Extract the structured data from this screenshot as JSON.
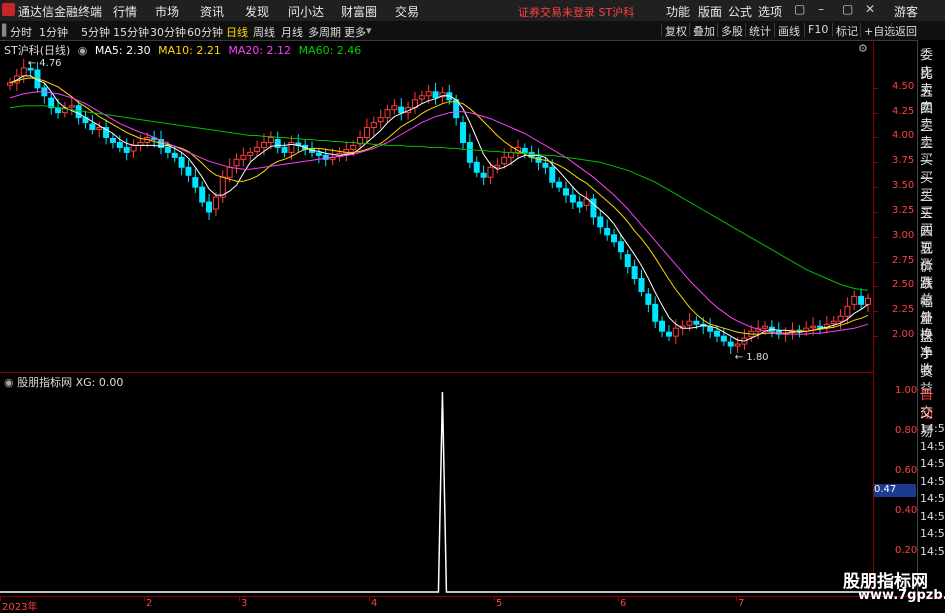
{
  "app": {
    "title": "通达信金融终端"
  },
  "menu": [
    "行情",
    "市场",
    "资讯",
    "发现",
    "问小达",
    "财富圈",
    "交易"
  ],
  "notice": "证券交易未登录  ST沪科",
  "right_menu": [
    "功能",
    "版面",
    "公式",
    "选项"
  ],
  "user": "游客",
  "window_buttons": [
    "▢",
    "–",
    "▢",
    "✕"
  ],
  "periods": [
    "分时",
    "1分钟",
    "5分钟",
    "15分钟",
    "30分钟",
    "60分钟",
    "日线",
    "周线",
    "月线",
    "多周期",
    "更多"
  ],
  "active_period": "日线",
  "chart_tools": [
    "复权",
    "叠加",
    "多股",
    "统计",
    "画线",
    "F10",
    "标记",
    "+自选",
    "返回"
  ],
  "main_legend": {
    "stock": "ST沪科(日线)",
    "ma5": "MA5: 2.30",
    "ma10": "MA10: 2.21",
    "ma20": "MA20: 2.12",
    "ma60": "MA60: 2.46"
  },
  "indicator_legend": {
    "name": "股朋指标网",
    "xg": "XG: 0.00"
  },
  "side_panel": [
    "委比",
    "卖五",
    "卖四",
    "卖三",
    "卖二",
    "卖一",
    "买一",
    "买二",
    "买三",
    "买四",
    "买五",
    "现价",
    "涨跌",
    "涨幅",
    "总量",
    "外盘",
    "换手",
    "净资",
    "收益"
  ],
  "side_bottom": [
    "自动",
    "交易"
  ],
  "side_times": [
    "14:53",
    "14:54",
    "14:54",
    "14:55",
    "14:55",
    "14:55",
    "14:55",
    "14:56"
  ],
  "xg_marker": "0.47",
  "x_dates": [
    "2023年",
    "2",
    "3",
    "4",
    "5",
    "6",
    "7"
  ],
  "watermark": {
    "line1": "股朋指标网",
    "line2": "www.7gpzb.com"
  },
  "colors": {
    "up": "#ff3c3c",
    "down": "#00e5ff",
    "ma5": "#ffffff",
    "ma10": "#ffd700",
    "ma20": "#ff40ff",
    "ma60": "#00c000",
    "axis": "#8b0000"
  },
  "chart_data": [
    {
      "type": "candlestick",
      "title": "ST沪科(日线)",
      "ylim": [
        1.8,
        4.76
      ],
      "y_ticks": [
        4.5,
        4.25,
        4.0,
        3.75,
        3.5,
        3.25,
        3.0,
        2.75,
        2.5,
        2.25,
        2.0
      ],
      "annotations": [
        {
          "label": "4.76",
          "type": "high"
        },
        {
          "label": "1.80",
          "type": "low"
        }
      ],
      "closes": [
        4.55,
        4.62,
        4.7,
        4.68,
        4.5,
        4.42,
        4.3,
        4.25,
        4.3,
        4.32,
        4.2,
        4.15,
        4.08,
        4.1,
        4.0,
        3.95,
        3.9,
        3.85,
        3.92,
        3.95,
        4.0,
        3.98,
        3.9,
        3.85,
        3.8,
        3.7,
        3.62,
        3.5,
        3.35,
        3.25,
        3.4,
        3.6,
        3.7,
        3.78,
        3.82,
        3.85,
        3.9,
        3.95,
        4.0,
        3.9,
        3.85,
        3.95,
        3.92,
        3.88,
        3.85,
        3.82,
        3.78,
        3.8,
        3.84,
        3.88,
        3.92,
        4.0,
        4.1,
        4.15,
        4.2,
        4.28,
        4.32,
        4.25,
        4.3,
        4.38,
        4.42,
        4.46,
        4.4,
        4.45,
        4.38,
        4.2,
        3.95,
        3.75,
        3.65,
        3.6,
        3.7,
        3.72,
        3.8,
        3.85,
        3.9,
        3.85,
        3.8,
        3.75,
        3.7,
        3.55,
        3.5,
        3.42,
        3.35,
        3.3,
        3.38,
        3.2,
        3.1,
        3.02,
        2.95,
        2.85,
        2.7,
        2.58,
        2.45,
        2.32,
        2.15,
        2.05,
        2.0,
        2.08,
        2.1,
        2.15,
        2.12,
        2.1,
        2.05,
        2.0,
        1.95,
        1.9,
        1.92,
        1.98,
        2.05,
        2.08,
        2.1,
        2.05,
        2.02,
        2.03,
        2.06,
        2.05,
        2.08,
        2.1,
        2.09,
        2.12,
        2.15,
        2.2,
        2.3,
        2.4,
        2.32,
        2.38
      ],
      "ma_series": [
        {
          "name": "MA5",
          "values": [
            4.55,
            4.58,
            4.62,
            4.62,
            4.58,
            4.55,
            4.46,
            4.36,
            4.3,
            4.27,
            4.24,
            4.2,
            4.16,
            4.12,
            4.08,
            4.04,
            3.98,
            3.94,
            3.92,
            3.92,
            3.92,
            3.92,
            3.91,
            3.92,
            3.89,
            3.85,
            3.79,
            3.7,
            3.6,
            3.48,
            3.42,
            3.42,
            3.46,
            3.52,
            3.64,
            3.75,
            3.81,
            3.86,
            3.91,
            3.92,
            3.92,
            3.93,
            3.92,
            3.9,
            3.87,
            3.86,
            3.84,
            3.83,
            3.82,
            3.83,
            3.84,
            3.89,
            3.95,
            4.01,
            4.07,
            4.15,
            4.21,
            4.24,
            4.27,
            4.3,
            4.34,
            4.37,
            4.39,
            4.42,
            4.42,
            4.38,
            4.29,
            4.15,
            3.99,
            3.83,
            3.73,
            3.68,
            3.7,
            3.74,
            3.79,
            3.82,
            3.82,
            3.82,
            3.8,
            3.73,
            3.66,
            3.58,
            3.5,
            3.43,
            3.39,
            3.33,
            3.27,
            3.21,
            3.13,
            3.02,
            2.92,
            2.82,
            2.71,
            2.58,
            2.44,
            2.31,
            2.19,
            2.12,
            2.08,
            2.08,
            2.09,
            2.11,
            2.1,
            2.08,
            2.04,
            2.0,
            1.96,
            1.95,
            1.98,
            2.01,
            2.05,
            2.07,
            2.06,
            2.06,
            2.05,
            2.04,
            2.05,
            2.06,
            2.08,
            2.09,
            2.11,
            2.13,
            2.17,
            2.23,
            2.27,
            2.32
          ]
        },
        {
          "name": "MA10",
          "values": [
            4.55,
            4.57,
            4.59,
            4.6,
            4.59,
            4.57,
            4.54,
            4.51,
            4.46,
            4.41,
            4.35,
            4.31,
            4.26,
            4.21,
            4.17,
            4.13,
            4.09,
            4.05,
            4.02,
            3.99,
            3.98,
            3.96,
            3.94,
            3.93,
            3.91,
            3.89,
            3.86,
            3.8,
            3.74,
            3.67,
            3.62,
            3.6,
            3.58,
            3.56,
            3.56,
            3.58,
            3.61,
            3.66,
            3.72,
            3.76,
            3.78,
            3.81,
            3.85,
            3.88,
            3.89,
            3.89,
            3.88,
            3.87,
            3.86,
            3.85,
            3.85,
            3.86,
            3.88,
            3.91,
            3.94,
            3.99,
            4.05,
            4.11,
            4.15,
            4.19,
            4.24,
            4.28,
            4.31,
            4.34,
            4.36,
            4.36,
            4.34,
            4.29,
            4.23,
            4.16,
            4.09,
            4.02,
            3.96,
            3.91,
            3.87,
            3.83,
            3.8,
            3.78,
            3.77,
            3.75,
            3.72,
            3.68,
            3.63,
            3.58,
            3.54,
            3.48,
            3.42,
            3.36,
            3.3,
            3.23,
            3.15,
            3.06,
            2.98,
            2.89,
            2.79,
            2.68,
            2.57,
            2.47,
            2.38,
            2.29,
            2.22,
            2.16,
            2.12,
            2.1,
            2.08,
            2.06,
            2.04,
            2.03,
            2.02,
            2.02,
            2.03,
            2.03,
            2.03,
            2.03,
            2.04,
            2.05,
            2.05,
            2.06,
            2.07,
            2.08,
            2.09,
            2.11,
            2.13,
            2.16,
            2.18,
            2.21
          ]
        },
        {
          "name": "MA20",
          "values": [
            4.4,
            4.42,
            4.44,
            4.45,
            4.46,
            4.46,
            4.45,
            4.44,
            4.42,
            4.4,
            4.37,
            4.34,
            4.3,
            4.26,
            4.22,
            4.18,
            4.14,
            4.11,
            4.08,
            4.05,
            4.03,
            4.0,
            3.97,
            3.94,
            3.91,
            3.88,
            3.85,
            3.82,
            3.79,
            3.76,
            3.74,
            3.72,
            3.7,
            3.69,
            3.68,
            3.68,
            3.69,
            3.7,
            3.71,
            3.72,
            3.73,
            3.74,
            3.75,
            3.76,
            3.77,
            3.78,
            3.79,
            3.8,
            3.81,
            3.82,
            3.83,
            3.85,
            3.87,
            3.89,
            3.92,
            3.95,
            3.99,
            4.03,
            4.07,
            4.11,
            4.15,
            4.18,
            4.21,
            4.23,
            4.25,
            4.26,
            4.26,
            4.25,
            4.23,
            4.21,
            4.19,
            4.16,
            4.13,
            4.1,
            4.07,
            4.04,
            4.0,
            3.96,
            3.92,
            3.88,
            3.84,
            3.8,
            3.75,
            3.7,
            3.65,
            3.6,
            3.54,
            3.48,
            3.42,
            3.35,
            3.28,
            3.2,
            3.12,
            3.04,
            2.96,
            2.88,
            2.8,
            2.72,
            2.64,
            2.56,
            2.49,
            2.42,
            2.35,
            2.29,
            2.24,
            2.19,
            2.15,
            2.12,
            2.09,
            2.07,
            2.05,
            2.04,
            2.03,
            2.02,
            2.02,
            2.02,
            2.02,
            2.03,
            2.03,
            2.04,
            2.05,
            2.06,
            2.07,
            2.08,
            2.1,
            2.12
          ]
        },
        {
          "name": "MA60",
          "values": [
            4.3,
            4.31,
            4.32,
            4.32,
            4.32,
            4.32,
            4.31,
            4.3,
            4.29,
            4.28,
            4.27,
            4.26,
            4.25,
            4.24,
            4.23,
            4.22,
            4.21,
            4.2,
            4.19,
            4.18,
            4.17,
            4.16,
            4.15,
            4.14,
            4.13,
            4.12,
            4.11,
            4.1,
            4.09,
            4.08,
            4.07,
            4.06,
            4.05,
            4.04,
            4.03,
            4.02,
            4.02,
            4.01,
            4.01,
            4.0,
            4.0,
            3.99,
            3.99,
            3.98,
            3.98,
            3.97,
            3.97,
            3.96,
            3.96,
            3.95,
            3.95,
            3.94,
            3.94,
            3.93,
            3.93,
            3.92,
            3.92,
            3.92,
            3.91,
            3.91,
            3.91,
            3.9,
            3.9,
            3.9,
            3.89,
            3.89,
            3.88,
            3.88,
            3.87,
            3.87,
            3.86,
            3.86,
            3.85,
            3.85,
            3.84,
            3.84,
            3.83,
            3.83,
            3.82,
            3.82,
            3.81,
            3.8,
            3.79,
            3.78,
            3.77,
            3.76,
            3.75,
            3.73,
            3.71,
            3.69,
            3.67,
            3.64,
            3.61,
            3.58,
            3.55,
            3.51,
            3.47,
            3.43,
            3.39,
            3.35,
            3.31,
            3.27,
            3.23,
            3.19,
            3.15,
            3.11,
            3.07,
            3.03,
            2.99,
            2.95,
            2.91,
            2.87,
            2.83,
            2.79,
            2.75,
            2.71,
            2.67,
            2.64,
            2.61,
            2.58,
            2.55,
            2.52,
            2.5,
            2.48,
            2.47,
            2.46
          ]
        }
      ]
    },
    {
      "type": "line",
      "title": "股朋指标网",
      "series": [
        {
          "name": "XG",
          "values": "pulse"
        }
      ],
      "ylim": [
        0,
        1
      ],
      "y_ticks": [
        1.0,
        0.8,
        0.6,
        0.4,
        0.2
      ],
      "peak_index": 63,
      "peak_value": 1.0
    }
  ]
}
